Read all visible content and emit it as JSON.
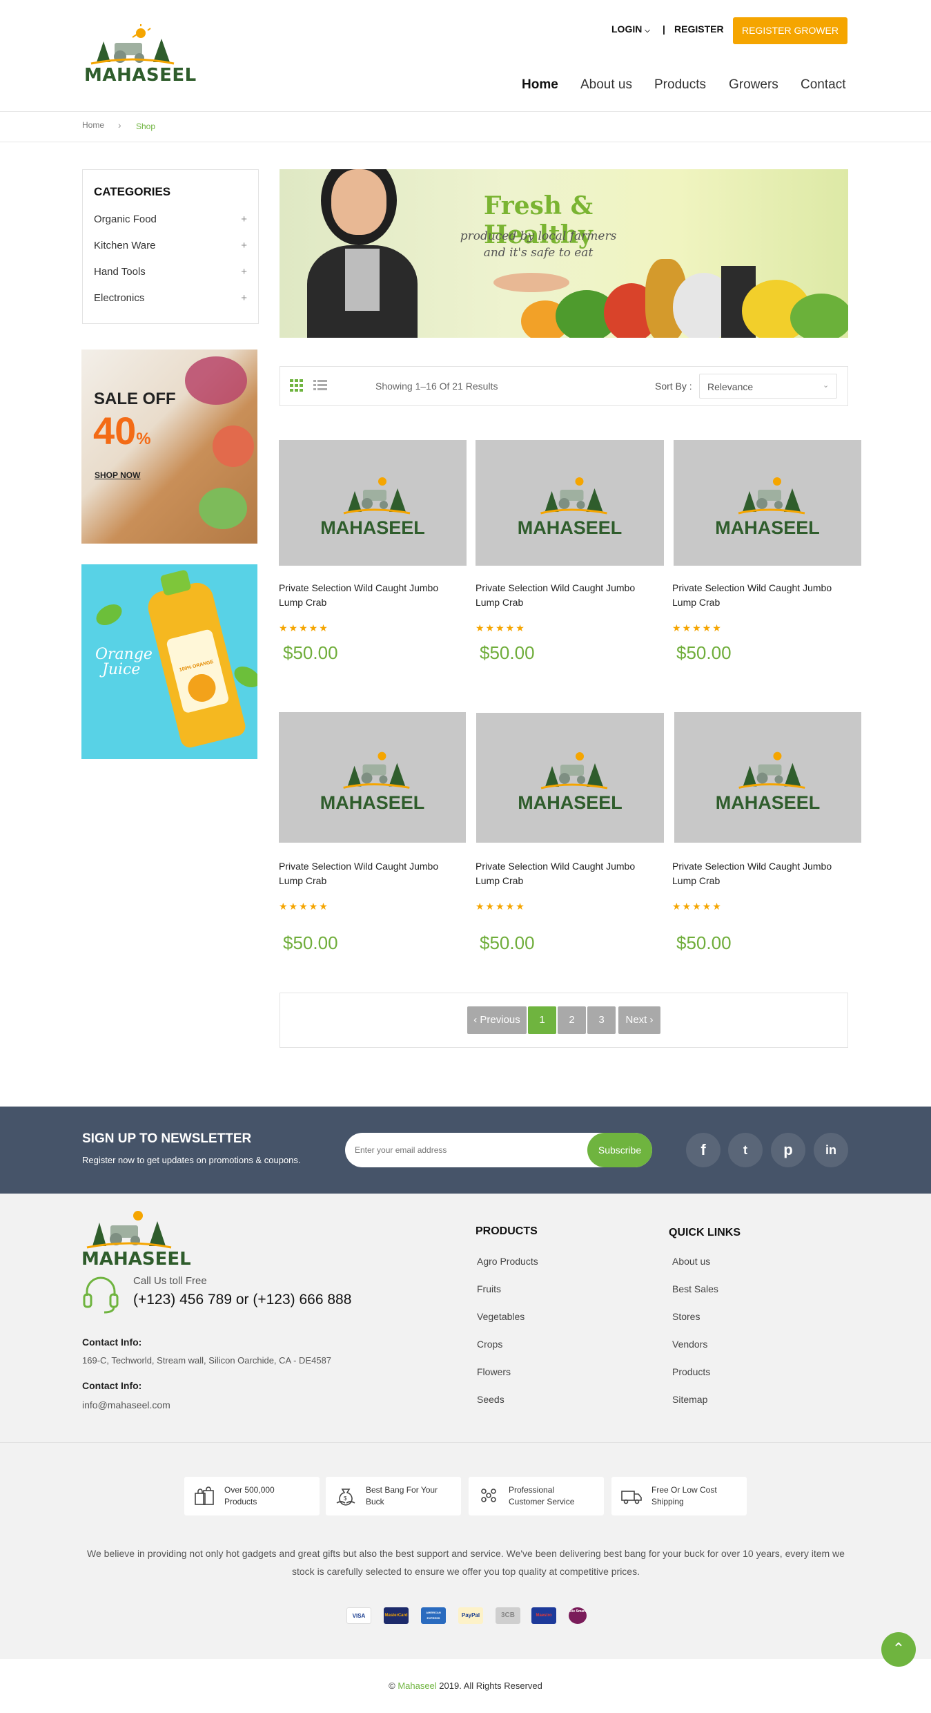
{
  "header": {
    "logo_text": "MAHASEEL",
    "login_label": "LOGIN",
    "separator": "|",
    "register_label": "REGISTER",
    "register_grower_label": "REGISTER GROWER",
    "nav": [
      "Home",
      "About us",
      "Products",
      "Growers",
      "Contact"
    ]
  },
  "breadcrumb": {
    "home": "Home",
    "sep": "›",
    "current": "Shop"
  },
  "sidebar": {
    "categories_title": "CATEGORIES",
    "categories": [
      {
        "label": "Organic Food",
        "toggle": "+"
      },
      {
        "label": "Kitchen Ware",
        "toggle": "+"
      },
      {
        "label": "Hand Tools",
        "toggle": "+"
      },
      {
        "label": "Electronics",
        "toggle": "+"
      }
    ],
    "promo_sale": {
      "line1": "SALE OFF",
      "percent": "40",
      "percent_sign": "%",
      "cta": "SHOP NOW"
    },
    "promo_juice": {
      "label_line1": "Orange",
      "label_line2": "Juice",
      "bottle_text": "100% ORANGE"
    }
  },
  "banner": {
    "title": "Fresh & Healthy",
    "line1": "produced by local farmers",
    "line2": "and it's safe to eat"
  },
  "toolbar": {
    "results": "Showing 1–16 Of 21 Results",
    "sort_label": "Sort By :",
    "sort_value": "Relevance"
  },
  "products": [
    {
      "name": "Private Selection Wild Caught Jumbo Lump Crab",
      "stars": "★★★★★",
      "price": "$50.00",
      "logo": "MAHASEEL"
    },
    {
      "name": "Private Selection Wild Caught Jumbo Lump Crab",
      "stars": "★★★★★",
      "price": "$50.00",
      "logo": "MAHASEEL"
    },
    {
      "name": "Private Selection Wild Caught Jumbo Lump Crab",
      "stars": "★★★★★",
      "price": "$50.00",
      "logo": "MAHASEEL"
    },
    {
      "name": "Private Selection Wild Caught Jumbo Lump Crab",
      "stars": "★★★★★",
      "price": "$50.00",
      "logo": "MAHASEEL"
    },
    {
      "name": "Private Selection Wild Caught Jumbo Lump Crab",
      "stars": "★★★★★",
      "price": "$50.00",
      "logo": "MAHASEEL"
    },
    {
      "name": "Private Selection Wild Caught Jumbo Lump Crab",
      "stars": "★★★★★",
      "price": "$50.00",
      "logo": "MAHASEEL"
    }
  ],
  "pagination": {
    "prev": "‹ Previous",
    "pages": [
      "1",
      "2",
      "3"
    ],
    "current": "1",
    "next": "Next ›",
    "active_color": "#6fb43f"
  },
  "newsletter": {
    "title": "SIGN UP TO NEWSLETTER",
    "subtitle": "Register now to get updates on promotions & coupons.",
    "placeholder": "Enter your email address",
    "button": "Subscribe",
    "socials": [
      "f",
      "t",
      "p",
      "in"
    ]
  },
  "footer": {
    "logo_text": "MAHASEEL",
    "call_label": "Call Us toll Free",
    "phone": "(+123) 456 789 or (+123) 666 888",
    "contact1_title": "Contact Info:",
    "contact1_value": "169-C, Techworld, Stream wall, Silicon Oarchide, CA - DE4587",
    "contact2_title": "Contact Info:",
    "contact2_value": "info@mahaseel.com",
    "products_title": "PRODUCTS",
    "products_links": [
      "Agro Products",
      "Fruits",
      "Vegetables",
      "Crops",
      "Flowers",
      "Seeds"
    ],
    "quick_title": "QUICK LINKS",
    "quick_links": [
      "About us",
      "Best Sales",
      "Stores",
      "Vendors",
      "Products",
      "Sitemap"
    ],
    "features": [
      {
        "l1": "Over 500,000",
        "l2": "Products",
        "icon": "shopping-bags-icon"
      },
      {
        "l1": "Best Bang For Your",
        "l2": "Buck",
        "icon": "money-bag-icon"
      },
      {
        "l1": "Professional",
        "l2": "Customer Service",
        "icon": "team-icon"
      },
      {
        "l1": "Free Or Low Cost",
        "l2": "Shipping",
        "icon": "truck-icon"
      }
    ],
    "about": "We believe in providing not only hot gadgets and great gifts but also the best support and service. We've been delivering best bang for your buck for over 10 years, every item we stock is carefully selected to ensure we offer you top quality at competitive prices.",
    "payments": [
      "VISA",
      "MasterCard",
      "AMERICAN EXPRESS",
      "PayPal",
      "3CB",
      "Maestro",
      "Die Smart"
    ]
  },
  "copyright": {
    "prefix": "© ",
    "brand": "Mahaseel",
    "suffix": " 2019. All Rights Reserved"
  },
  "colors": {
    "accent_green": "#6fb43f",
    "accent_orange": "#f5a500",
    "newsletter_bg": "#465469",
    "brand_dark_green": "#2f5d2c"
  }
}
